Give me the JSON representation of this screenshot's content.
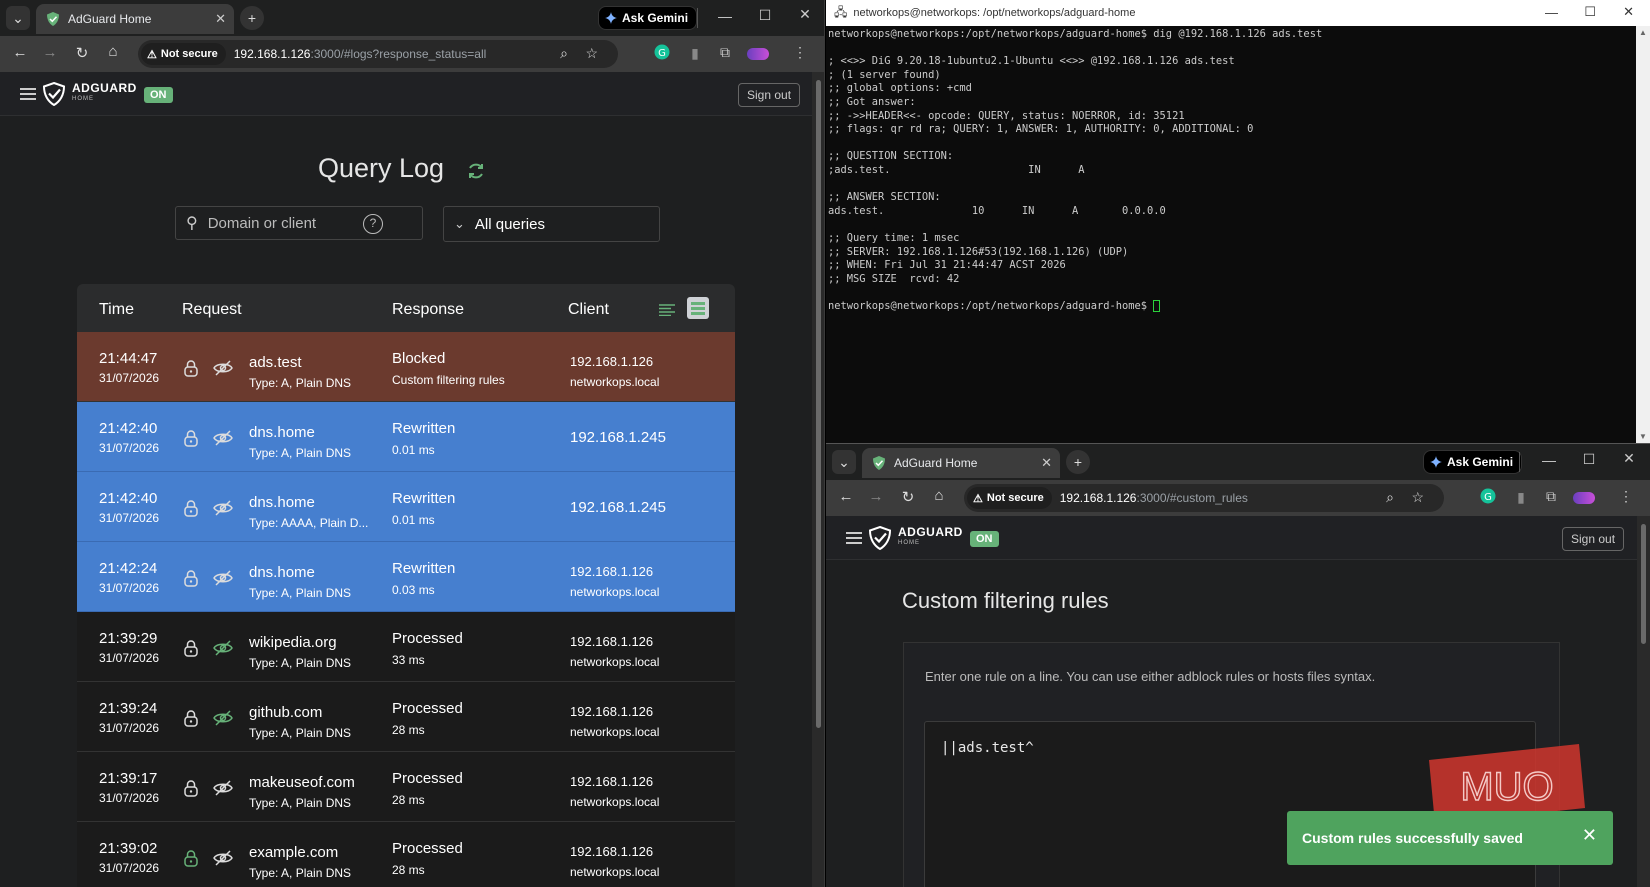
{
  "left_browser": {
    "tab_title": "AdGuard Home",
    "ask_gemini": "Ask Gemini",
    "not_secure": "Not secure",
    "url_host": "192.168.1.126",
    "url_rest": ":3000/#logs?response_status=all",
    "brand": "ADGUARD",
    "brand_sub": "HOME",
    "on_badge": "ON",
    "sign_out": "Sign out",
    "page_title": "Query Log",
    "search_placeholder": "Domain or client",
    "filter_label": "All queries",
    "columns": {
      "time": "Time",
      "request": "Request",
      "response": "Response",
      "client": "Client"
    },
    "rows": [
      {
        "time": "21:44:47",
        "date": "31/07/2026",
        "domain": "ads.test",
        "type": "Type: A, Plain DNS",
        "response": "Blocked",
        "response_sub": "Custom filtering rules",
        "client": "192.168.1.126",
        "client_sub": "networkops.local"
      },
      {
        "time": "21:42:40",
        "date": "31/07/2026",
        "domain": "dns.home",
        "type": "Type: A, Plain DNS",
        "response": "Rewritten",
        "response_sub": "0.01 ms",
        "client": "192.168.1.245",
        "client_sub": ""
      },
      {
        "time": "21:42:40",
        "date": "31/07/2026",
        "domain": "dns.home",
        "type": "Type: AAAA, Plain D...",
        "response": "Rewritten",
        "response_sub": "0.01 ms",
        "client": "192.168.1.245",
        "client_sub": ""
      },
      {
        "time": "21:42:24",
        "date": "31/07/2026",
        "domain": "dns.home",
        "type": "Type: A, Plain DNS",
        "response": "Rewritten",
        "response_sub": "0.03 ms",
        "client": "192.168.1.126",
        "client_sub": "networkops.local"
      },
      {
        "time": "21:39:29",
        "date": "31/07/2026",
        "domain": "wikipedia.org",
        "type": "Type: A, Plain DNS",
        "response": "Processed",
        "response_sub": "33 ms",
        "client": "192.168.1.126",
        "client_sub": "networkops.local"
      },
      {
        "time": "21:39:24",
        "date": "31/07/2026",
        "domain": "github.com",
        "type": "Type: A, Plain DNS",
        "response": "Processed",
        "response_sub": "28 ms",
        "client": "192.168.1.126",
        "client_sub": "networkops.local"
      },
      {
        "time": "21:39:17",
        "date": "31/07/2026",
        "domain": "makeuseof.com",
        "type": "Type: A, Plain DNS",
        "response": "Processed",
        "response_sub": "28 ms",
        "client": "192.168.1.126",
        "client_sub": "networkops.local"
      },
      {
        "time": "21:39:02",
        "date": "31/07/2026",
        "domain": "example.com",
        "type": "Type: A, Plain DNS",
        "response": "Processed",
        "response_sub": "28 ms",
        "client": "192.168.1.126",
        "client_sub": "networkops.local"
      }
    ]
  },
  "terminal": {
    "title": "networkops@networkops: /opt/networkops/adguard-home",
    "lines": [
      "networkops@networkops:/opt/networkops/adguard-home$ dig @192.168.1.126 ads.test",
      "",
      "; <<>> DiG 9.20.18-1ubuntu2.1-Ubuntu <<>> @192.168.1.126 ads.test",
      "; (1 server found)",
      ";; global options: +cmd",
      ";; Got answer:",
      ";; ->>HEADER<<- opcode: QUERY, status: NOERROR, id: 35121",
      ";; flags: qr rd ra; QUERY: 1, ANSWER: 1, AUTHORITY: 0, ADDITIONAL: 0",
      "",
      ";; QUESTION SECTION:",
      ";ads.test.                      IN      A",
      "",
      ";; ANSWER SECTION:",
      "ads.test.              10      IN      A       0.0.0.0",
      "",
      ";; Query time: 1 msec",
      ";; SERVER: 192.168.1.126#53(192.168.1.126) (UDP)",
      ";; WHEN: Fri Jul 31 21:44:47 ACST 2026",
      ";; MSG SIZE  rcvd: 42",
      ""
    ],
    "prompt": "networkops@networkops:/opt/networkops/adguard-home$ "
  },
  "right_browser": {
    "tab_title": "AdGuard Home",
    "ask_gemini": "Ask Gemini",
    "not_secure": "Not secure",
    "url_host": "192.168.1.126",
    "url_rest": ":3000/#custom_rules",
    "brand": "ADGUARD",
    "brand_sub": "HOME",
    "on_badge": "ON",
    "sign_out": "Sign out",
    "page_title": "Custom filtering rules",
    "description": "Enter one rule on a line. You can use either adblock rules or hosts files syntax.",
    "rules_text": "||ads.test^",
    "toast": "Custom rules successfully saved",
    "watermark": "MUO"
  },
  "colors": {
    "blocked_row": "#6b3a2e",
    "rewritten_row": "#467fcf",
    "on_badge": "#67b279",
    "toast": "#4fa35e",
    "accent_green": "#67b279"
  }
}
